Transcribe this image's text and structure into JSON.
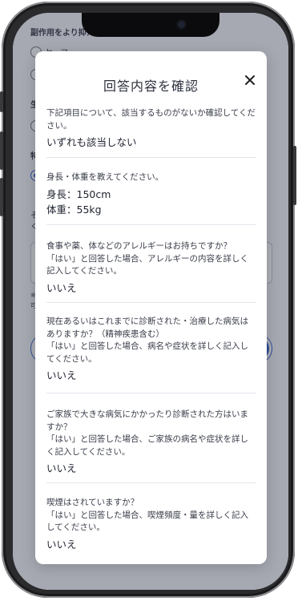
{
  "background": {
    "section_label": "副作用をより抑えた",
    "option_label": "セーフ",
    "frag_1": "生",
    "frag_2": "特",
    "frag_3": "そ",
    "frag_4": "く",
    "frag_5": "※",
    "frag_6": "可"
  },
  "modal": {
    "title": "回答内容を確認",
    "close_icon": "close-icon",
    "items": [
      {
        "question": "下記項目について、該当するものがないか確認してください。",
        "answers": [
          "いずれも該当しない"
        ]
      },
      {
        "question": "身長・体重を教えてください。",
        "answers": [
          "身長：150cm",
          "体重：55kg"
        ]
      },
      {
        "question": "食事や薬、体などのアレルギーはお持ちですか？\n「はい」と回答した場合、アレルギーの内容を詳しく記入してください。",
        "answers": [
          "いいえ"
        ]
      },
      {
        "question": "現在あるいはこれまでに診断された・治療した病気はありますか？（精神疾患含む）\n「はい」と回答した場合、病名や症状を詳しく記入してください。",
        "answers": [
          "いいえ"
        ]
      },
      {
        "question": "ご家族で大きな病気にかかったり診断された方はいますか？\n「はい」と回答した場合、ご家族の病名や症状を詳しく記入してください。",
        "answers": [
          "いいえ"
        ]
      },
      {
        "question": "喫煙はされていますか？\n「はい」と回答した場合、喫煙頻度・量を詳しく記入してください。",
        "answers": [
          "いいえ"
        ]
      }
    ]
  },
  "colors": {
    "accent": "#2a58c8",
    "overlay": "#3c4052"
  }
}
